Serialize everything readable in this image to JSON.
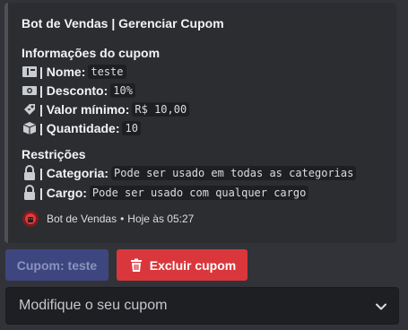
{
  "embed": {
    "title": "Bot de Vendas | Gerenciar Cupom",
    "info_title": "Informações do cupom",
    "fields": [
      {
        "icon": "ticket-icon",
        "label": "| Nome:",
        "value": "teste"
      },
      {
        "icon": "money-icon",
        "label": "| Desconto:",
        "value": "10%"
      },
      {
        "icon": "price-tag-icon",
        "label": "| Valor mínimo:",
        "value": "R$ 10,00"
      },
      {
        "icon": "package-icon",
        "label": "| Quantidade:",
        "value": "10"
      }
    ],
    "restrictions_title": "Restrições",
    "restrictions": [
      {
        "icon": "lock-icon",
        "label": "| Categoria:",
        "value": "Pode ser usado em todas as categorias"
      },
      {
        "icon": "lock-icon",
        "label": "| Cargo:",
        "value": "Pode ser usado com qualquer cargo"
      }
    ],
    "footer": {
      "author": "Bot de Vendas",
      "separator": "•",
      "time": "Hoje às 05:27"
    }
  },
  "buttons": {
    "coupon_label": "Cupom: teste",
    "delete_label": "Excluir cupom"
  },
  "select": {
    "placeholder": "Modifique o seu cupom"
  },
  "colors": {
    "embed_bar": "#4e5058",
    "danger": "#da373c",
    "blurple_disabled": "#3e4680"
  }
}
